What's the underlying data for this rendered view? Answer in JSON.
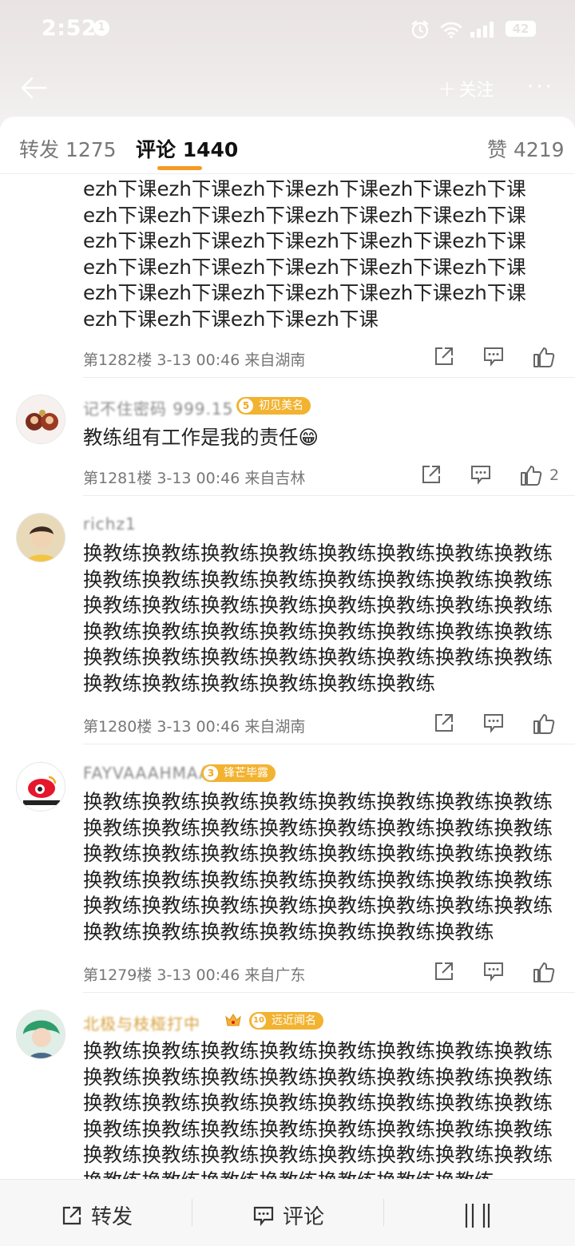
{
  "status_bar": {
    "time": "2:52",
    "notif_count": "1",
    "battery": "42"
  },
  "nav": {
    "follow_label": "关注"
  },
  "tabs": {
    "repost": "转发 1275",
    "comment": "评论 1440",
    "like": "赞 4219"
  },
  "comments": [
    {
      "text": "ezh下课ezh下课ezh下课ezh下课ezh下课ezh下课ezh下课ezh下课ezh下课ezh下课ezh下课ezh下课ezh下课ezh下课ezh下课ezh下课ezh下课ezh下课ezh下课ezh下课ezh下课ezh下课ezh下课ezh下课ezh下课ezh下课ezh下课ezh下课ezh下课ezh下课ezh下课ezh下课ezh下课ezh下课",
      "meta": "第1282楼 3-13 00:46 来自湖南"
    },
    {
      "username": "记不住密码 999.15",
      "badge": {
        "level": "5",
        "title": "初见美名"
      },
      "text": "教练组有工作是我的责任😁",
      "meta": "第1281楼 3-13 00:46 来自吉林",
      "likes": "2"
    },
    {
      "username": "richz1",
      "text": "换教练换教练换教练换教练换教练换教练换教练换教练换教练换教练换教练换教练换教练换教练换教练换教练换教练换教练换教练换教练换教练换教练换教练换教练换教练换教练换教练换教练换教练换教练换教练换教练换教练换教练换教练换教练换教练换教练换教练换教练换教练换教练换教练换教练换教练换教练",
      "meta": "第1280楼 3-13 00:46 来自湖南"
    },
    {
      "username": "FAYVAAAHMAAA",
      "badge": {
        "level": "3",
        "title": "锋芒毕露"
      },
      "text": "换教练换教练换教练换教练换教练换教练换教练换教练换教练换教练换教练换教练换教练换教练换教练换教练换教练换教练换教练换教练换教练换教练换教练换教练换教练换教练换教练换教练换教练换教练换教练换教练换教练换教练换教练换教练换教练换教练换教练换教练换教练换教练换教练换教练换教练换教练换教练",
      "meta": "第1279楼 3-13 00:46 来自广东"
    },
    {
      "username": "北极与枝桠打中",
      "badge": {
        "level": "10",
        "title": "远近闻名"
      },
      "text": "换教练换教练换教练换教练换教练换教练换教练换教练换教练换教练换教练换教练换教练换教练换教练换教练换教练换教练换教练换教练换教练换教练换教练换教练换教练换教练换教练换教练换教练换教练换教练换教练换教练换教练换教练换教练换教练换教练换教练换教练换教练换教练换教练换教练换教练换教练换教练"
    }
  ],
  "bottom_bar": {
    "repost": "转发",
    "comment": "评论"
  }
}
